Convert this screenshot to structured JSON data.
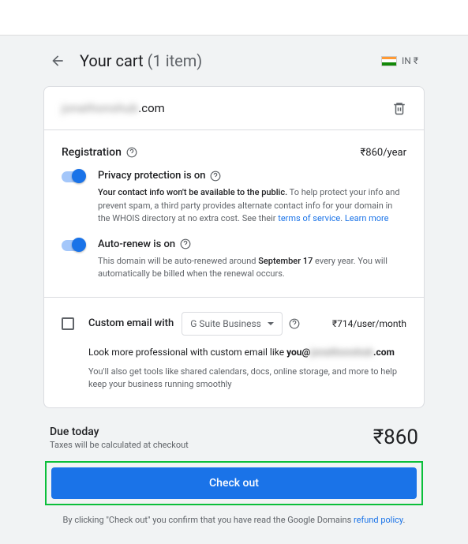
{
  "header": {
    "title_prefix": "Your cart",
    "title_count": "(1 item)",
    "locale_label": "IN ₹"
  },
  "domain": {
    "name_redacted": "jonathonshub",
    "tld": ".com"
  },
  "registration": {
    "title": "Registration",
    "price": "₹860/year"
  },
  "privacy": {
    "label": "Privacy protection is on",
    "desc_bold": "Your contact info won't be available to the public.",
    "desc_rest": " To help protect your info and prevent spam, a third party provides alternate contact info for your domain in the WHOIS directory at no extra cost. See their ",
    "link1": "terms of service",
    "sep": ". ",
    "link2": "Learn more"
  },
  "autorenew": {
    "label": "Auto-renew is on",
    "desc_pre": "This domain will be auto-renewed around ",
    "desc_date": "September 17",
    "desc_post": " every year. You will automatically be billed when the renewal occurs."
  },
  "email": {
    "label": "Custom email with",
    "select_value": "G Suite Business",
    "price": "₹714/user/month",
    "look_pre": "Look more professional with custom email like ",
    "look_bold_pre": "you@",
    "look_redacted": "jonathonshub",
    "look_bold_post": ".com",
    "smalldesc": "You'll also get tools like shared calendars, docs, online storage, and more to help keep your business running smoothly"
  },
  "due": {
    "label": "Due today",
    "tax": "Taxes will be calculated at checkout",
    "amount": "₹860"
  },
  "checkout": {
    "button": "Check out",
    "legal_pre": "By clicking \"Check out\" you confirm that you have read the Google Domains ",
    "legal_link": "refund policy",
    "legal_post": "."
  }
}
